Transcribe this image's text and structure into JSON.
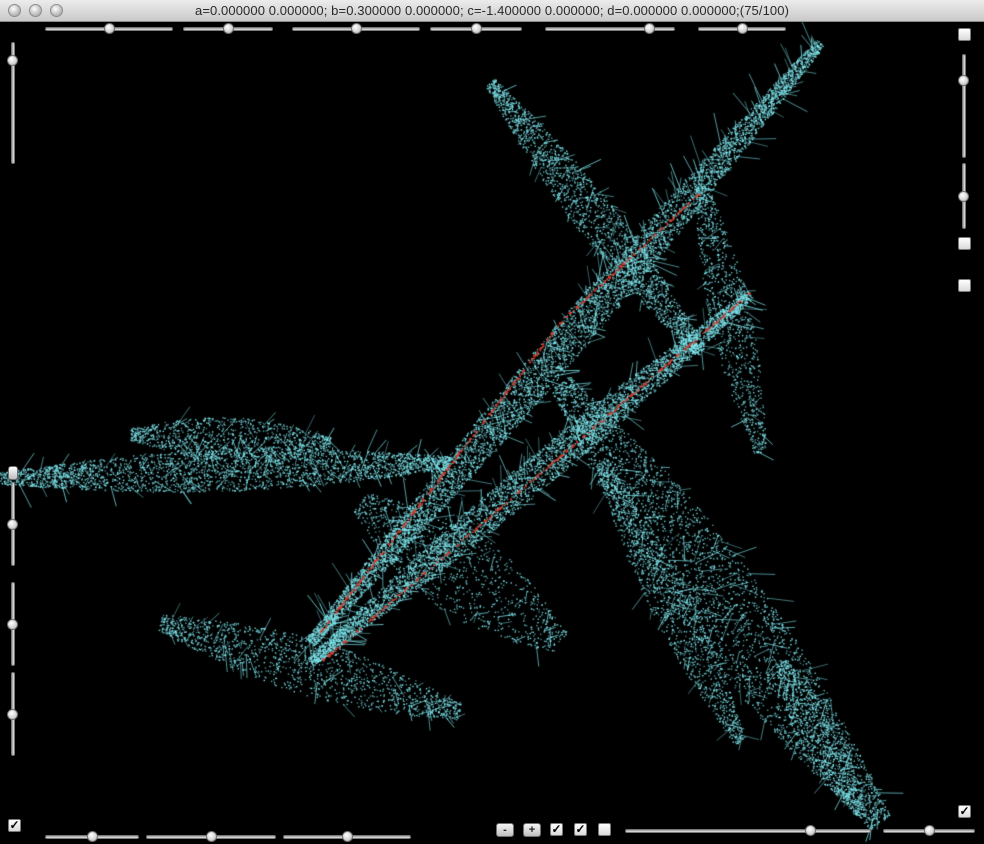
{
  "window": {
    "title": "a=0.000000 0.000000; b=0.300000 0.000000; c=-1.400000 0.000000; d=0.000000 0.000000;(75/100)"
  },
  "controls": {
    "minus_label": "-",
    "plus_label": "+",
    "check_mark": "✓",
    "top_sliders": [
      0.5,
      0.5,
      0.5,
      0.5,
      0.8,
      0.5
    ],
    "bottom_sliders": [
      0.5,
      0.5,
      0.5
    ],
    "bottom_right_sliders": [
      0.75,
      0.5
    ],
    "left_sliders": [
      0.85,
      0.5,
      0.5,
      0.5
    ],
    "right_sliders": [
      0.75,
      0.5
    ]
  },
  "colors": {
    "background": "#000000",
    "fractal_primary": "#7fe9f0",
    "fractal_accent": "#d83a2a"
  }
}
